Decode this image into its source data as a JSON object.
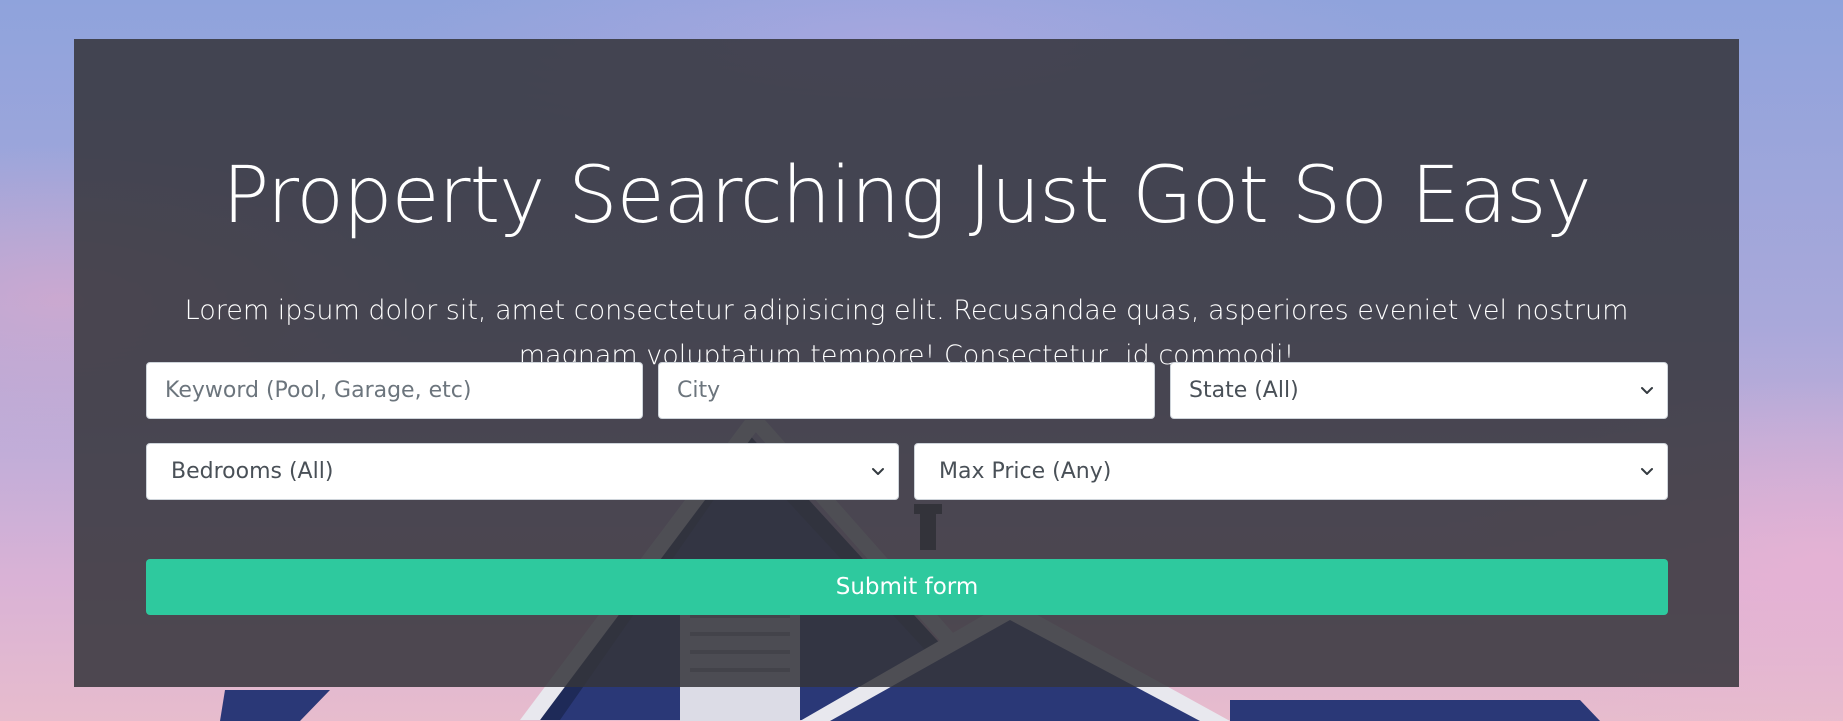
{
  "hero": {
    "title": "Property Searching Just Got So Easy",
    "lead": "Lorem ipsum dolor sit, amet consectetur adipisicing elit. Recusandae quas, asperiores eveniet vel nostrum magnam voluptatum tempore! Consectetur, id commodi!"
  },
  "search_form": {
    "keyword": {
      "value": "",
      "placeholder": "Keyword (Pool, Garage, etc)"
    },
    "city": {
      "value": "",
      "placeholder": "City"
    },
    "state": {
      "selected": "State (All)",
      "icon": "chevron-down-icon"
    },
    "bedrooms": {
      "selected": "Bedrooms (All)",
      "icon": "chevron-down-icon"
    },
    "max_price": {
      "selected": "Max Price (Any)",
      "icon": "chevron-down-icon"
    },
    "submit_label": "Submit form"
  },
  "colors": {
    "overlay": "#34343a",
    "accent": "#2ec99e",
    "text_on_dark": "#ffffff",
    "input_text": "#495057"
  }
}
